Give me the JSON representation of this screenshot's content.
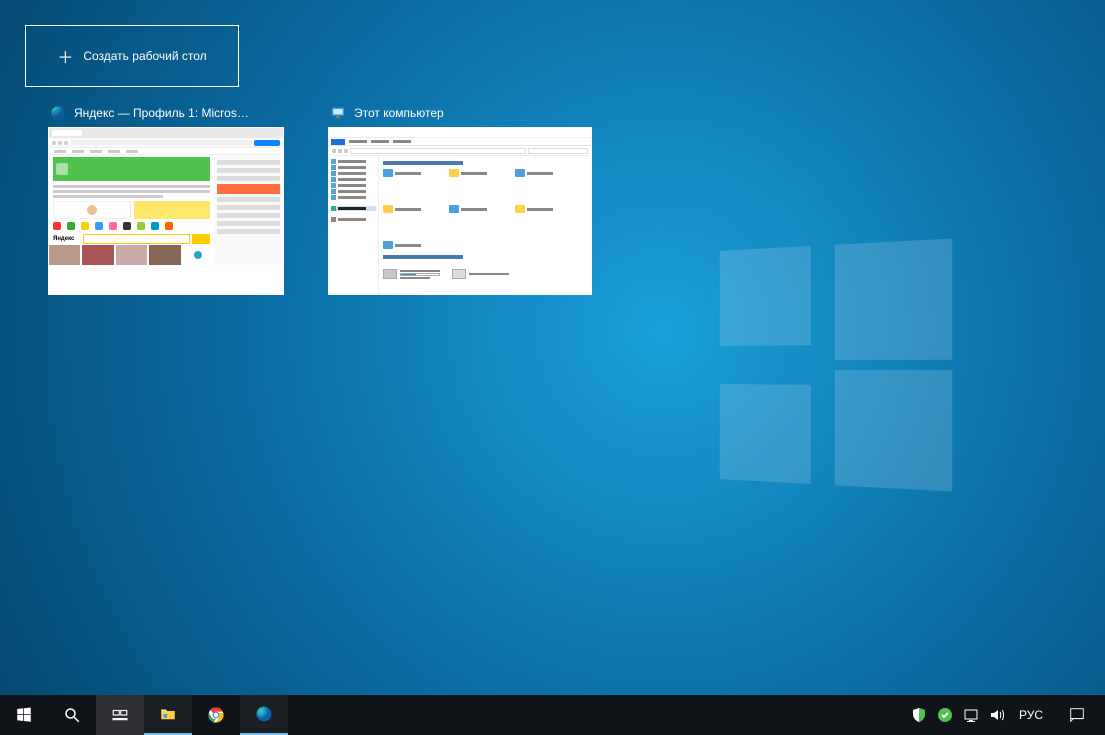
{
  "new_desktop_label": "Создать рабочий стол",
  "windows": [
    {
      "title": "Яндекс — Профиль 1: Micros…",
      "app": "edge",
      "search_logo": "Яндекс"
    },
    {
      "title": "Этот компьютер",
      "app": "explorer"
    }
  ],
  "taskbar": {
    "language": "РУС"
  }
}
